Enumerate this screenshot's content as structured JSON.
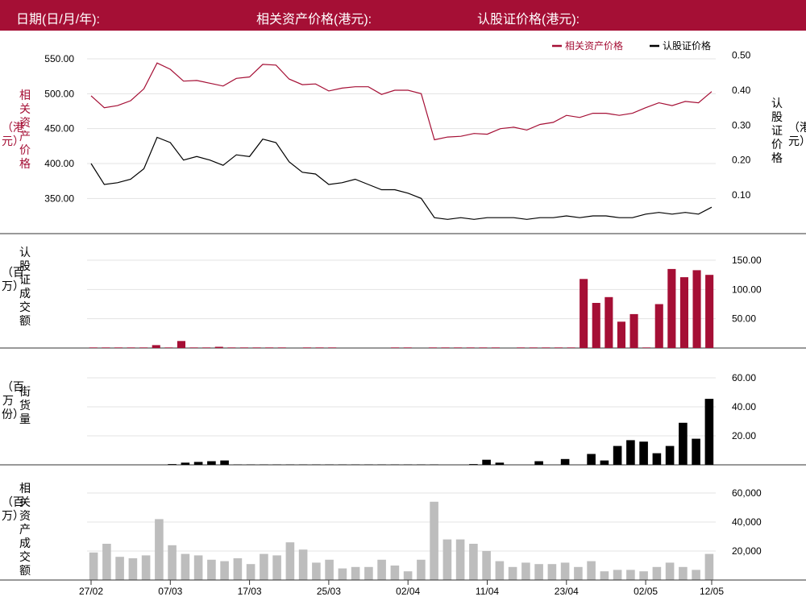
{
  "header": {
    "date_label": "日期(日/月/年):",
    "underlying_label": "相关资产价格(港元):",
    "warrant_label": "认股证价格(港元):"
  },
  "colors": {
    "accent": "#a50f35",
    "warrant": "#000000",
    "volume_grey": "#bdbdbd"
  },
  "panels": {
    "price": {
      "left_label_a": "相关资产价格",
      "left_label_b": "（港元）",
      "right_label_a": "认股证价格",
      "right_label_b": "（港元）"
    },
    "warrant_turnover": {
      "label_a": "认股证成交额",
      "label_b": "（百万）"
    },
    "outstanding": {
      "label_a": "街货量",
      "label_b": "（百万份）"
    },
    "underlying_turnover": {
      "label_a": "相关资产成交额",
      "label_b": "（百万）"
    }
  },
  "chart_data": [
    {
      "type": "line",
      "legend_position": "top-right",
      "grid": true,
      "x_tick_labels": [
        "27/02",
        "07/03",
        "17/03",
        "25/03",
        "02/04",
        "11/04",
        "23/04",
        "02/05",
        "12/05"
      ],
      "x_tick_index": [
        0,
        6,
        12,
        18,
        24,
        30,
        36,
        42,
        47
      ],
      "series": [
        {
          "name": "相关资产价格",
          "axis": "left",
          "color": "#a50f35",
          "values": [
            497,
            480,
            483,
            490,
            507,
            544,
            535,
            518,
            519,
            515,
            511,
            522,
            524,
            542,
            541,
            521,
            513,
            514,
            504,
            508,
            510,
            510,
            499,
            505,
            505,
            500,
            434,
            438,
            439,
            443,
            442,
            450,
            452,
            448,
            456,
            459,
            469,
            466,
            472,
            472,
            469,
            472,
            480,
            487,
            483,
            489,
            487,
            503
          ]
        },
        {
          "name": "认股证价格",
          "axis": "right",
          "color": "#000000",
          "values": [
            0.19,
            0.13,
            0.135,
            0.145,
            0.175,
            0.265,
            0.25,
            0.2,
            0.21,
            0.2,
            0.185,
            0.215,
            0.21,
            0.26,
            0.25,
            0.195,
            0.165,
            0.16,
            0.13,
            0.135,
            0.145,
            0.13,
            0.115,
            0.115,
            0.105,
            0.09,
            0.035,
            0.03,
            0.035,
            0.03,
            0.035,
            0.035,
            0.035,
            0.03,
            0.035,
            0.035,
            0.04,
            0.035,
            0.04,
            0.04,
            0.035,
            0.035,
            0.045,
            0.05,
            0.045,
            0.05,
            0.045,
            0.065
          ]
        }
      ],
      "left_ticks": [
        "350.00",
        "400.00",
        "450.00",
        "500.00",
        "550.00"
      ],
      "left_ylim": [
        325,
        565
      ],
      "right_ticks": [
        "0.10",
        "0.20",
        "0.30",
        "0.40",
        "0.50"
      ],
      "right_ylim": [
        0.04,
        0.52
      ]
    },
    {
      "type": "bar",
      "name": "认股证成交额",
      "color": "#a50f35",
      "ticks": [
        "50.00",
        "100.00",
        "150.00"
      ],
      "ylim": [
        0,
        150
      ],
      "values": [
        1,
        1,
        1,
        1,
        1,
        5,
        1,
        12,
        1,
        1,
        2,
        1,
        1,
        1,
        1,
        1,
        0,
        1,
        1,
        1,
        0,
        0,
        0,
        0,
        1,
        1,
        0,
        1,
        1,
        1,
        1,
        1,
        1,
        0,
        1,
        1,
        1,
        1,
        1,
        118,
        77,
        87,
        45,
        58,
        1,
        75,
        135,
        121,
        133,
        125
      ]
    },
    {
      "type": "bar",
      "name": "街货量",
      "color": "#000000",
      "ticks": [
        "20.00",
        "40.00",
        "60.00"
      ],
      "ylim": [
        0,
        60
      ],
      "values": [
        0,
        0,
        0,
        0,
        0,
        0,
        0.5,
        1.5,
        2,
        2.5,
        3,
        0.3,
        0.3,
        0.3,
        0.3,
        0.3,
        0.3,
        0.3,
        0.3,
        0.3,
        0.3,
        0.3,
        0.3,
        0.3,
        0.3,
        0.3,
        0.3,
        0,
        0,
        0.5,
        3.5,
        1.5,
        0,
        0,
        2.5,
        0,
        4,
        0,
        7.5,
        3,
        13,
        17,
        16,
        8,
        13,
        29,
        18,
        45.5
      ]
    },
    {
      "type": "bar",
      "name": "相关资产成交额",
      "color": "#bdbdbd",
      "ticks": [
        "20,000",
        "40,000",
        "60,000"
      ],
      "ylim": [
        0,
        60000
      ],
      "values": [
        19000,
        25000,
        16000,
        15000,
        17000,
        42000,
        24000,
        18000,
        17000,
        14000,
        13000,
        15000,
        11000,
        18000,
        17000,
        26000,
        21000,
        12000,
        14000,
        8000,
        9000,
        9000,
        14000,
        10000,
        6000,
        14000,
        54000,
        28000,
        28000,
        25000,
        20000,
        13000,
        9000,
        12000,
        11000,
        11000,
        12000,
        9000,
        13000,
        6000,
        7000,
        7000,
        6000,
        9000,
        12000,
        9000,
        7000,
        18000
      ]
    }
  ]
}
